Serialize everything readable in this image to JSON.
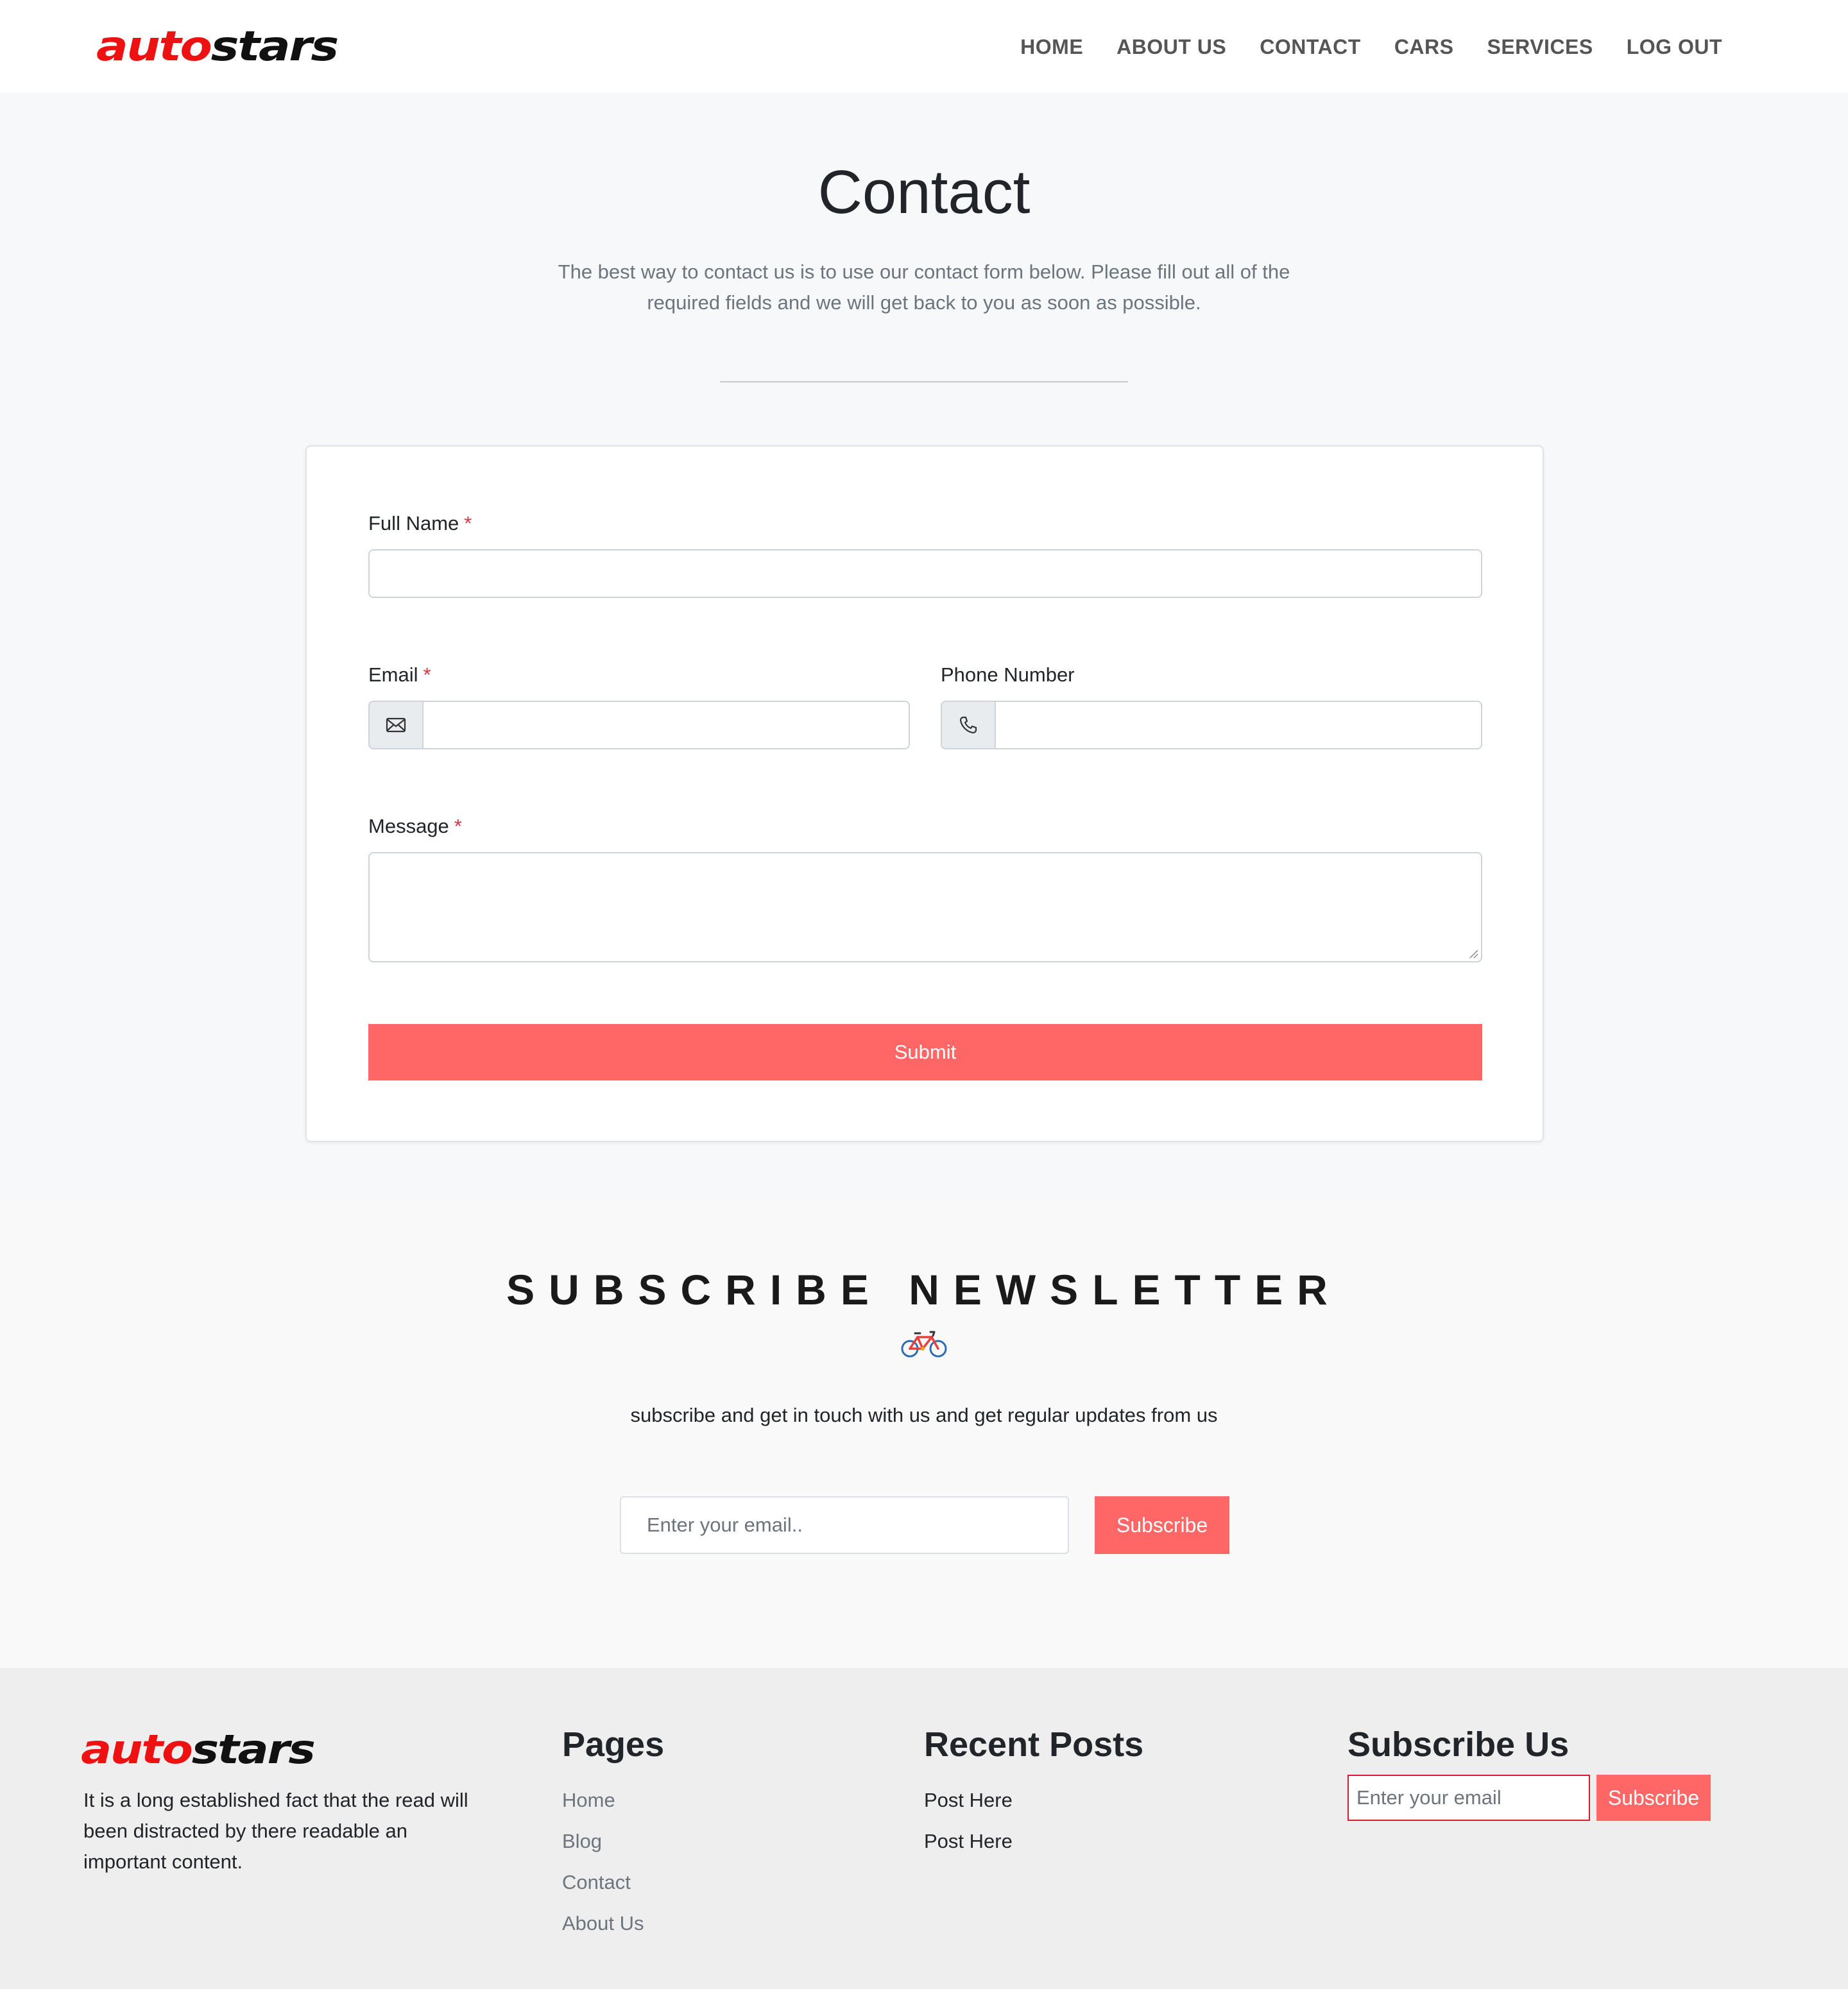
{
  "brand": {
    "logo_part1": "auto",
    "logo_part2": "stars"
  },
  "nav": {
    "items": [
      {
        "label": "HOME"
      },
      {
        "label": "ABOUT US"
      },
      {
        "label": "CONTACT"
      },
      {
        "label": "CARS"
      },
      {
        "label": "SERVICES"
      },
      {
        "label": "LOG OUT"
      }
    ]
  },
  "hero": {
    "title": "Contact",
    "subtitle": "The best way to contact us is to use our contact form below. Please fill out all of the required fields and we will get back to you as soon as possible."
  },
  "form": {
    "full_name_label": "Full Name",
    "email_label": "Email",
    "phone_label": "Phone Number",
    "message_label": "Message",
    "required_mark": "*",
    "full_name_value": "",
    "email_value": "",
    "phone_value": "",
    "message_value": "",
    "submit_label": "Submit",
    "email_icon": "envelope-icon",
    "phone_icon": "phone-icon"
  },
  "newsletter": {
    "title": "SUBSCRIBE NEWSLETTER",
    "icon": "bicycle-icon",
    "subtitle": "subscribe and get in touch with us and get regular updates from us",
    "email_placeholder": "Enter your email..",
    "button_label": "Subscribe"
  },
  "footer": {
    "about_text": "It is a long established fact that the read will been distracted by there readable an important content.",
    "pages_heading": "Pages",
    "pages": [
      {
        "label": "Home"
      },
      {
        "label": "Blog"
      },
      {
        "label": "Contact"
      },
      {
        "label": "About Us"
      }
    ],
    "recent_heading": "Recent Posts",
    "recent_posts": [
      {
        "label": "Post Here"
      },
      {
        "label": "Post Here"
      }
    ],
    "subscribe_heading": "Subscribe Us",
    "subscribe_placeholder": "Enter your email",
    "subscribe_button": "Subscribe"
  },
  "colors": {
    "accent": "#ff6666",
    "logo_red": "#ee1111",
    "required_red": "#dc3545",
    "page_bg": "#f7f8f9",
    "footer_bg": "#eeeeee"
  }
}
